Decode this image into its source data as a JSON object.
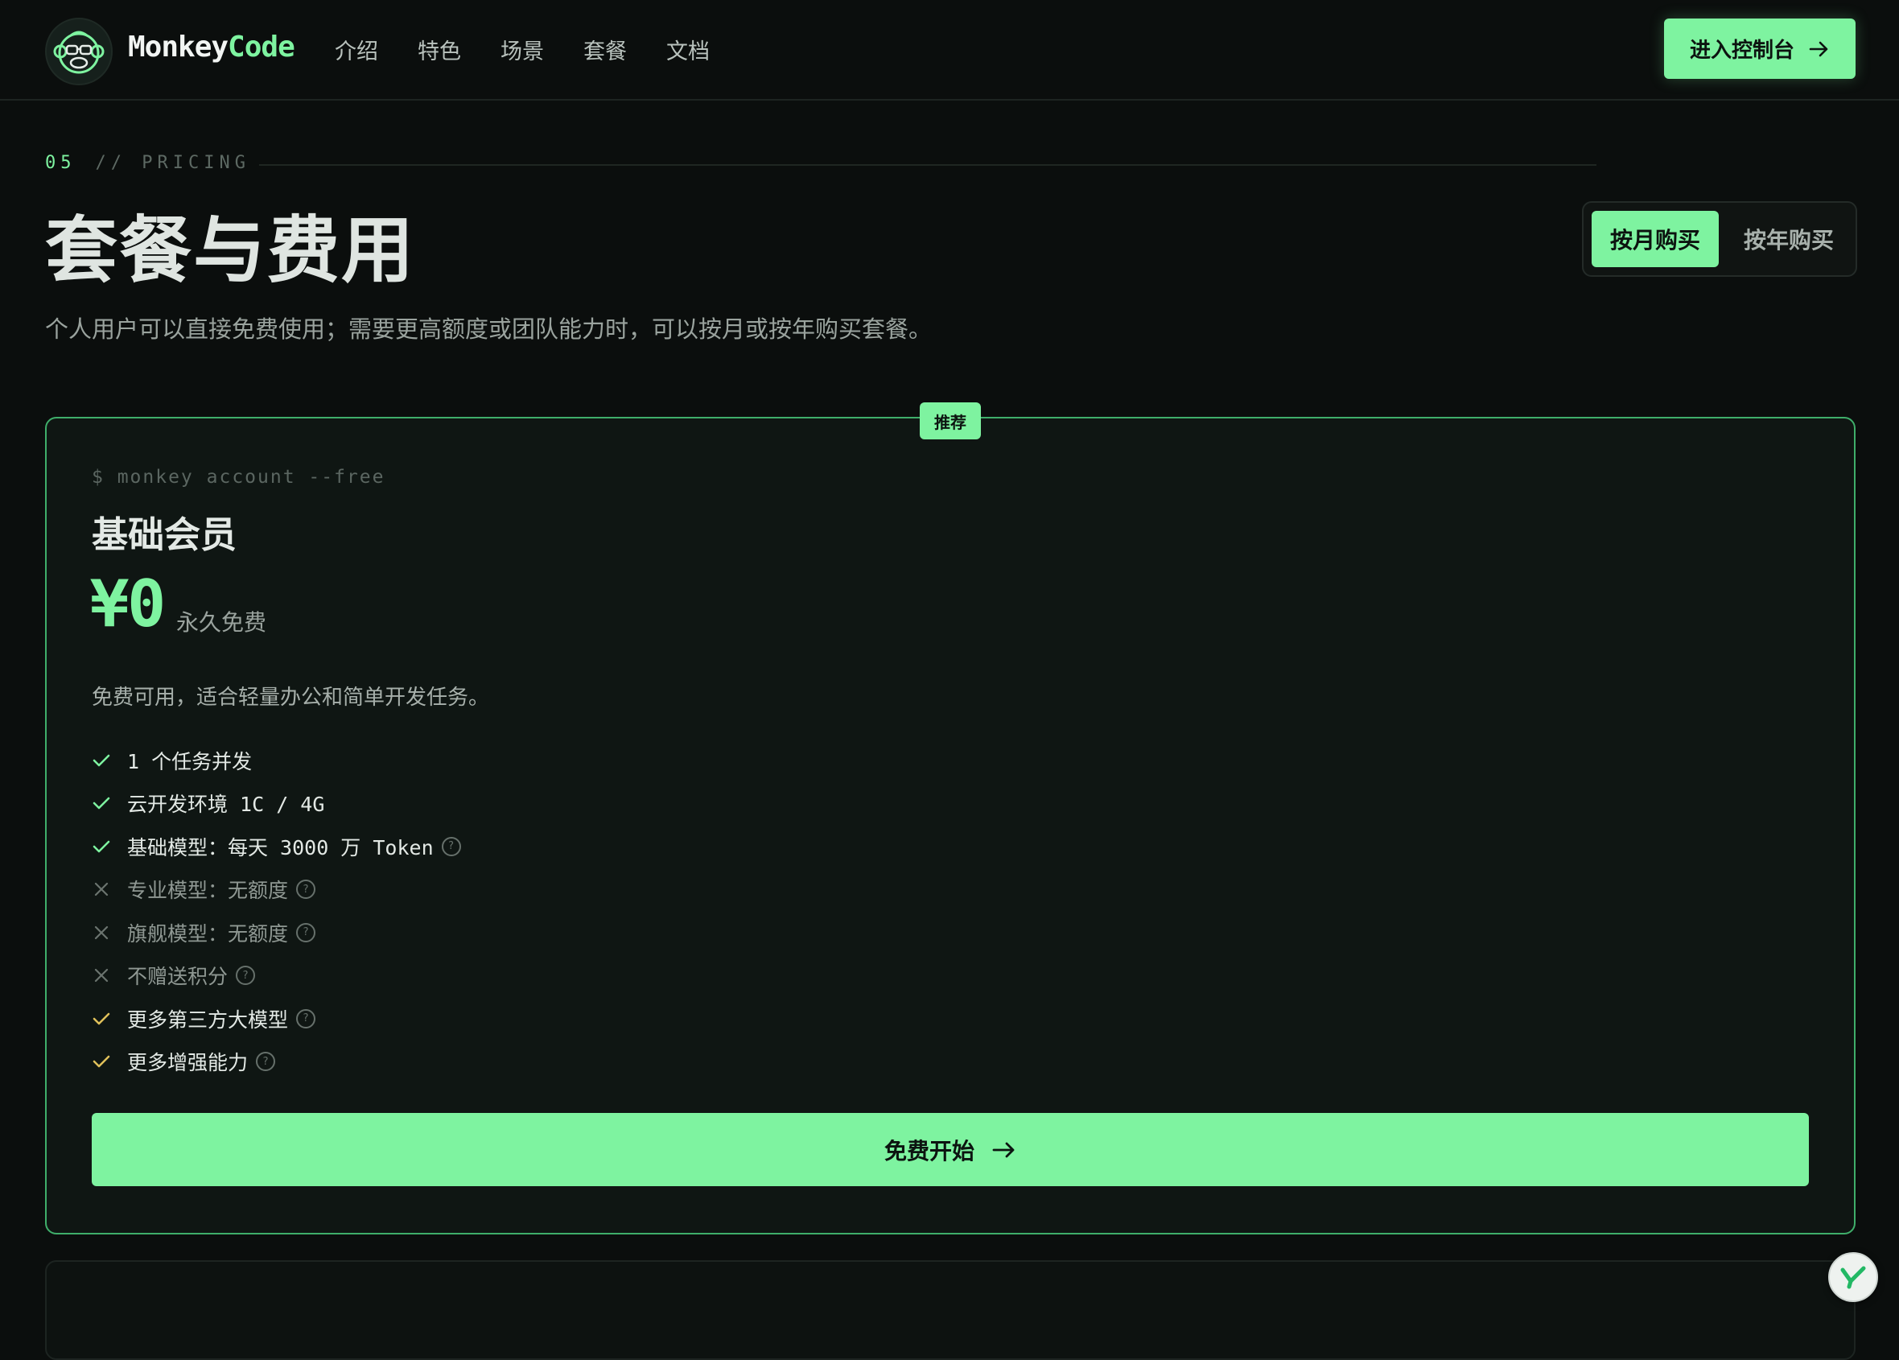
{
  "header": {
    "brand_primary": "Monkey",
    "brand_accent": "Code",
    "nav": [
      "介绍",
      "特色",
      "场景",
      "套餐",
      "文档"
    ],
    "console_button": "进入控制台"
  },
  "section": {
    "number": "05",
    "label": "// PRICING",
    "title": "套餐与费用",
    "subtitle": "个人用户可以直接免费使用；需要更高额度或团队能力时，可以按月或按年购买套餐。",
    "billing_toggle": {
      "monthly": "按月购买",
      "yearly": "按年购买",
      "selected": "monthly"
    }
  },
  "plan": {
    "badge": "推荐",
    "command": "$ monkey account --free",
    "name": "基础会员",
    "price": "¥0",
    "price_note": "永久免费",
    "description": "免费可用，适合轻量办公和简单开发任务。",
    "features": [
      {
        "text": "1 个任务并发",
        "status": "included",
        "help": false
      },
      {
        "text": "云开发环境 1C / 4G",
        "status": "included",
        "help": false
      },
      {
        "text": "基础模型：每天 3000 万 Token",
        "status": "included",
        "help": true
      },
      {
        "text": "专业模型：无额度",
        "status": "excluded",
        "help": true
      },
      {
        "text": "旗舰模型：无额度",
        "status": "excluded",
        "help": true
      },
      {
        "text": "不赠送积分",
        "status": "excluded",
        "help": true
      },
      {
        "text": "更多第三方大模型",
        "status": "extra",
        "help": true
      },
      {
        "text": "更多增强能力",
        "status": "extra",
        "help": true
      }
    ],
    "cta": "免费开始"
  },
  "colors": {
    "accent": "#7ef3a0",
    "background": "#0b0e0d",
    "card_border": "#3fae6a",
    "check_included": "#7ef3a0",
    "check_extra": "#e0c15a",
    "cross_excluded": "#6b746f"
  }
}
